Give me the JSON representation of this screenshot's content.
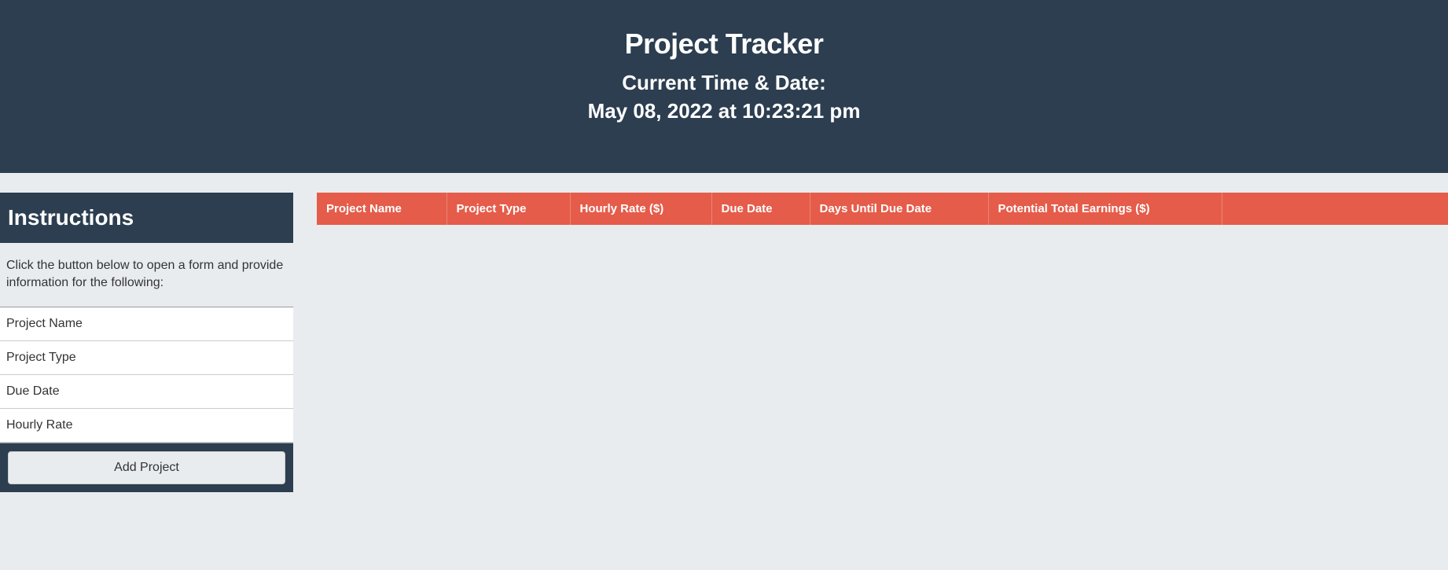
{
  "header": {
    "title": "Project Tracker",
    "subtitle_label": "Current Time & Date:",
    "datetime": "May 08, 2022 at 10:23:21 pm"
  },
  "sidebar": {
    "title": "Instructions",
    "description": "Click the button below to open a form and provide information for the following:",
    "items": [
      "Project Name",
      "Project Type",
      "Due Date",
      "Hourly Rate"
    ],
    "button_label": "Add Project"
  },
  "table": {
    "columns": [
      "Project Name",
      "Project Type",
      "Hourly Rate ($)",
      "Due Date",
      "Days Until Due Date",
      "Potential Total Earnings ($)",
      ""
    ],
    "rows": []
  }
}
